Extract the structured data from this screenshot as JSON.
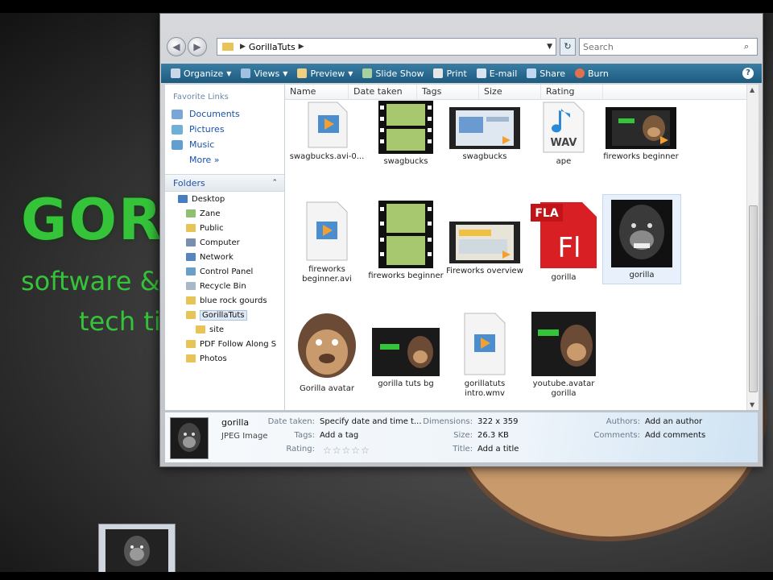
{
  "desktop": {
    "brand": "GORIL",
    "tagline1": "software &",
    "tagline2": "tech ti"
  },
  "window": {
    "address": {
      "path": "GorillaTuts"
    },
    "search": {
      "placeholder": "Search"
    },
    "toolbar": {
      "organize": "Organize",
      "views": "Views",
      "preview": "Preview",
      "slideshow": "Slide Show",
      "print": "Print",
      "email": "E-mail",
      "share": "Share",
      "burn": "Burn"
    },
    "favorites": {
      "header": "Favorite Links",
      "items": [
        "Documents",
        "Pictures",
        "Music"
      ],
      "more": "More"
    },
    "folders": {
      "header": "Folders",
      "tree": [
        "Desktop",
        "Zane",
        "Public",
        "Computer",
        "Network",
        "Control Panel",
        "Recycle Bin",
        "blue rock gourds",
        "GorillaTuts",
        "site",
        "PDF Follow Along S",
        "Photos"
      ]
    },
    "columns": [
      "Name",
      "Date taken",
      "Tags",
      "Size",
      "Rating"
    ],
    "files": [
      "swagbucks.avi-0...",
      "swagbucks",
      "swagbucks",
      "ape",
      "fireworks beginner",
      "fireworks beginner.avi",
      "fireworks beginner",
      "Fireworks overview",
      "gorilla",
      "gorilla",
      "Gorilla avatar",
      "gorilla tuts bg",
      "gorillatuts intro.wmv",
      "youtube.avatar gorilla"
    ],
    "icon_text": {
      "wav": "WAV",
      "fla": "FLA",
      "fl": "Fl"
    },
    "details": {
      "name": "gorilla",
      "type": "JPEG Image",
      "date_taken_label": "Date taken:",
      "date_taken_value": "Specify date and time t...",
      "tags_label": "Tags:",
      "tags_value": "Add a tag",
      "rating_label": "Rating:",
      "stars": "☆☆☆☆☆",
      "dimensions_label": "Dimensions:",
      "dimensions_value": "322 x 359",
      "size_label": "Size:",
      "size_value": "26.3 KB",
      "title_label": "Title:",
      "title_value": "Add a title",
      "authors_label": "Authors:",
      "authors_value": "Add an author",
      "comments_label": "Comments:",
      "comments_value": "Add comments"
    }
  },
  "colors": {
    "brand_green": "#35c33a",
    "toolbar_blue": "#1d5a7f",
    "link_blue": "#1a52a8"
  }
}
